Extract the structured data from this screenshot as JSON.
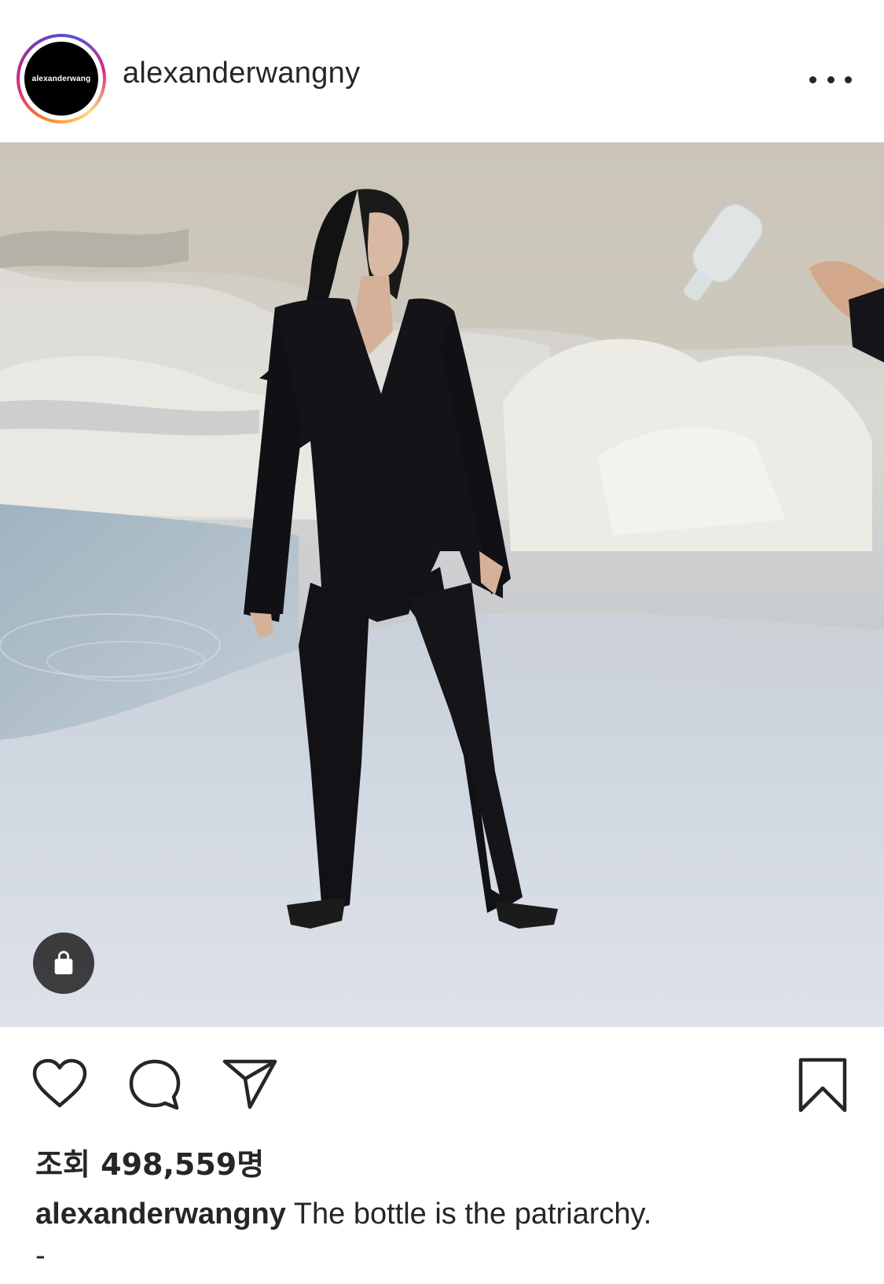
{
  "post": {
    "username": "alexanderwangny",
    "avatar_text": "alexanderwang",
    "more_icon": "more-horizontal-icon",
    "shop_icon": "shopping-bag-icon"
  },
  "actions": {
    "like_icon": "heart-icon",
    "comment_icon": "comment-icon",
    "share_icon": "send-icon",
    "save_icon": "bookmark-icon"
  },
  "stats": {
    "views_label": "조회 498,559명"
  },
  "caption": {
    "username": "alexanderwangny",
    "text": "The bottle is the patriarchy.",
    "trailing": "-"
  },
  "colors": {
    "text": "#262626",
    "badge_bg": "#262626",
    "avatar_bg": "#000000"
  }
}
